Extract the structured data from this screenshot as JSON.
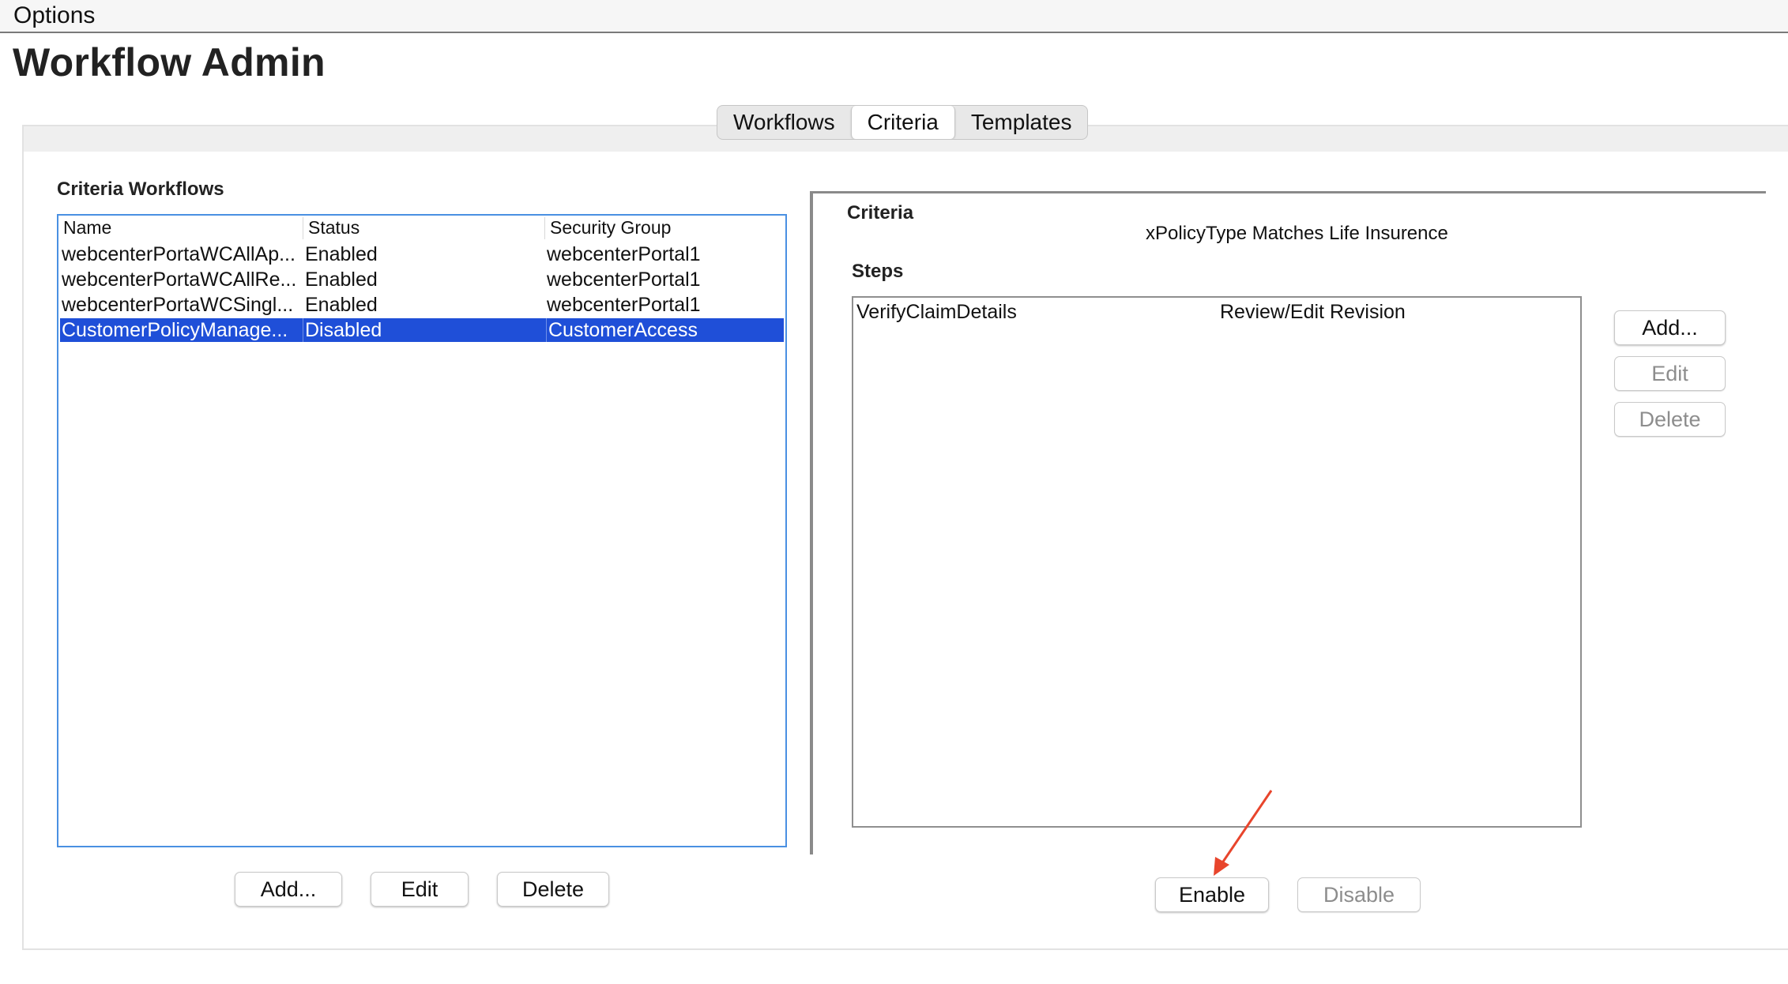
{
  "menubar": {
    "options_label": "Options"
  },
  "page": {
    "title": "Workflow Admin"
  },
  "tabs": [
    {
      "label": "Workflows",
      "active": false
    },
    {
      "label": "Criteria",
      "active": true
    },
    {
      "label": "Templates",
      "active": false
    }
  ],
  "left": {
    "section_title": "Criteria Workflows",
    "columns": [
      "Name",
      "Status",
      "Security Group"
    ],
    "rows": [
      {
        "name": "webcenterPortaWCAllAp...",
        "status": "Enabled",
        "group": "webcenterPortal1",
        "selected": false
      },
      {
        "name": "webcenterPortaWCAllRe...",
        "status": "Enabled",
        "group": "webcenterPortal1",
        "selected": false
      },
      {
        "name": "webcenterPortaWCSingl...",
        "status": "Enabled",
        "group": "webcenterPortal1",
        "selected": false
      },
      {
        "name": "CustomerPolicyManage...",
        "status": "Disabled",
        "group": "CustomerAccess",
        "selected": true
      }
    ],
    "buttons": {
      "add": "Add...",
      "edit": "Edit",
      "delete": "Delete"
    }
  },
  "right": {
    "criteria_label": "Criteria",
    "criteria_value": "xPolicyType Matches Life Insurence",
    "steps_label": "Steps",
    "steps": [
      {
        "name": "VerifyClaimDetails",
        "type": "Review/Edit Revision"
      }
    ],
    "side_buttons": {
      "add": "Add...",
      "edit": "Edit",
      "delete": "Delete"
    },
    "bottom_buttons": {
      "enable": "Enable",
      "disable": "Disable"
    }
  },
  "colors": {
    "selection": "#1f4fd8",
    "table_border": "#4a90e2",
    "annotation_arrow": "#e8452c"
  }
}
